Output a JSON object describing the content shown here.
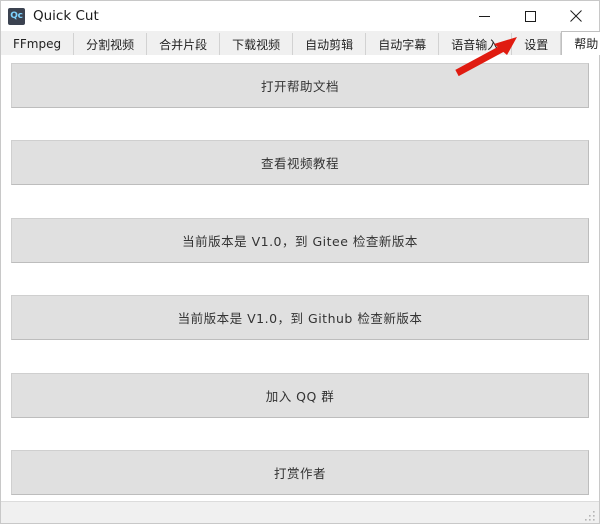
{
  "window": {
    "title": "Quick Cut",
    "app_icon": "app-icon-qc",
    "icon_text": "Qc",
    "controls": [
      {
        "name": "minimize-button",
        "icon": "minimize-icon",
        "label": "—"
      },
      {
        "name": "maximize-button",
        "icon": "maximize-icon",
        "label": "□"
      },
      {
        "name": "close-button",
        "icon": "close-icon",
        "label": "✕"
      }
    ]
  },
  "tabs": [
    {
      "label": "FFmpeg",
      "selected": false
    },
    {
      "label": "分割视频",
      "selected": false
    },
    {
      "label": "合并片段",
      "selected": false
    },
    {
      "label": "下载视频",
      "selected": false
    },
    {
      "label": "自动剪辑",
      "selected": false
    },
    {
      "label": "自动字幕",
      "selected": false
    },
    {
      "label": "语音输入",
      "selected": false
    },
    {
      "label": "设置",
      "selected": false
    },
    {
      "label": "帮助",
      "selected": true
    }
  ],
  "help_panel": {
    "buttons": [
      {
        "name": "open-help-doc-button",
        "label": "打开帮助文档"
      },
      {
        "name": "watch-video-tutorial-button",
        "label": "查看视频教程"
      },
      {
        "name": "check-update-gitee-button",
        "label": "当前版本是 V1.0，到 Gitee 检查新版本"
      },
      {
        "name": "check-update-github-button",
        "label": "当前版本是 V1.0，到 Github 检查新版本"
      },
      {
        "name": "join-qq-group-button",
        "label": "加入 QQ 群"
      },
      {
        "name": "donate-author-button",
        "label": "打赏作者"
      }
    ]
  },
  "annotation": {
    "name": "red-arrow-annotation",
    "color": "#e01b10",
    "points_to": "帮助"
  },
  "statusbar": {
    "text": "",
    "grip": "resize-grip-icon"
  },
  "colors": {
    "window_bg": "#ffffff",
    "tabbar_bg": "#f0f0f0",
    "button_bg": "#e0e0e0",
    "button_border": "#cfcfcf",
    "text": "#333333",
    "accent_red": "#e01b10"
  }
}
